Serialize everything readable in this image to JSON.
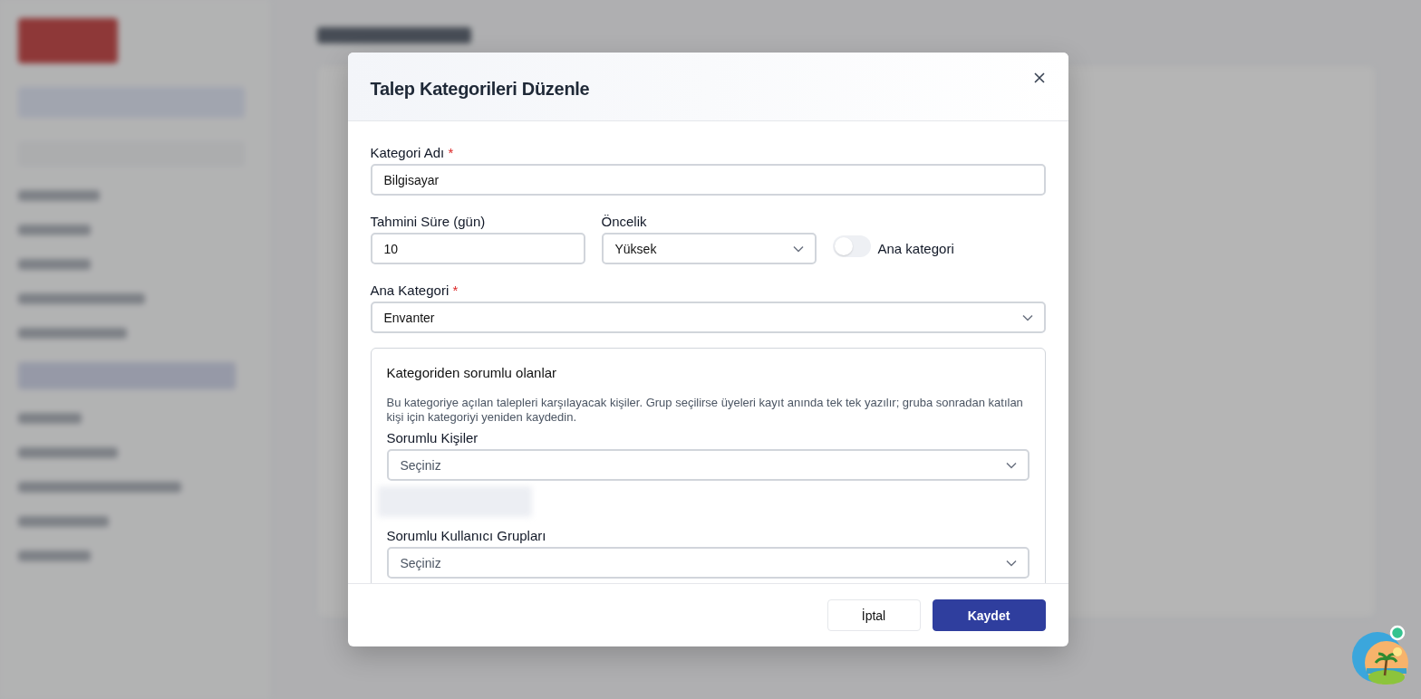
{
  "dialog": {
    "title": "Talep Kategorileri Düzenle",
    "fields": [
      {
        "kind": "text",
        "label": "Kategori Adı",
        "required_mark": "*",
        "value": "Bilgisayar"
      },
      {
        "kind": "text",
        "label": "Tahmini Süre (gün)",
        "value": "10"
      },
      {
        "kind": "select",
        "label": "Öncelik",
        "value": "Yüksek"
      },
      {
        "kind": "toggle",
        "label": "Ana kategori",
        "on": false
      },
      {
        "kind": "select",
        "label": "Ana Kategori",
        "required_mark": "*",
        "value": "Envanter"
      }
    ],
    "responsible": {
      "title": "Kategoriden sorumlu olanlar",
      "description": "Bu kategoriye açılan talepleri karşılayacak kişiler. Grup seçilirse üyeleri kayıt anında tek tek yazılır; gruba sonradan katılan kişi için kategoriyi yeniden kaydedin.",
      "selects": [
        {
          "label": "Sorumlu Kişiler",
          "placeholder": "Seçiniz"
        },
        {
          "label": "Sorumlu Kullanıcı Grupları",
          "placeholder": "Seçiniz"
        }
      ]
    },
    "buttons": [
      {
        "label": "İptal",
        "kind": "secondary"
      },
      {
        "label": "Kaydet",
        "kind": "primary"
      }
    ]
  }
}
